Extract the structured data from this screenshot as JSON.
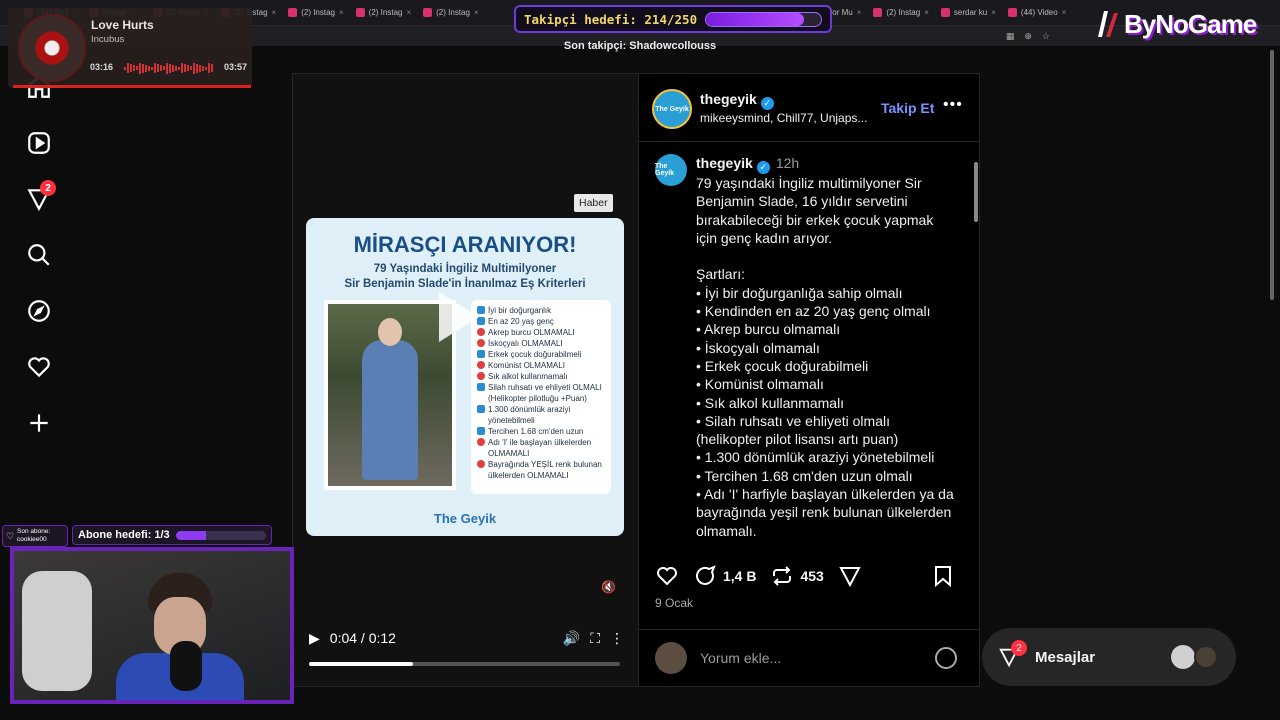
{
  "browser": {
    "tabs": [
      "(44) Youl",
      "Instagr",
      "(2) Instag",
      "(2) Instag",
      "(2) Instag",
      "(2) Instag",
      "(2) Instag",
      "Biliyor Mu",
      "(2) Instag",
      "serdar ku",
      "(44) Video"
    ]
  },
  "stream": {
    "follower_goal_label": "Takipçi hedefi: 214/250",
    "follower_goal_progress": 0.856,
    "last_follower": "Son takipçi: Shadowcollouss",
    "logo": "ByNoGame",
    "music": {
      "title": "Love Hurts",
      "artist": "Incubus",
      "elapsed": "03:16",
      "total": "03:57"
    },
    "last_sub_label": "Son abone:",
    "last_sub_name": "cookiee00",
    "sub_goal_label": "Abone hedefi: 1/3",
    "sub_goal_progress": 0.333
  },
  "nav": {
    "notifications_badge": "2"
  },
  "post": {
    "news_tag": "Haber",
    "card": {
      "headline": "MİRASÇI ARANIYOR!",
      "subtitle1": "79 Yaşındaki İngiliz Multimilyoner",
      "subtitle2": "Sir Benjamin Slade'in İnanılmaz Eş Kriterleri",
      "brand": "The Geyik",
      "list": [
        {
          "ok": true,
          "text": "İyi bir doğurganlık"
        },
        {
          "ok": true,
          "text": "En az 20 yaş genç"
        },
        {
          "ok": false,
          "text": "Akrep burcu OLMAMALI"
        },
        {
          "ok": false,
          "text": "İskoçyalı OLMAMALI"
        },
        {
          "ok": true,
          "text": "Erkek çocuk doğurabilmeli"
        },
        {
          "ok": false,
          "text": "Komünist OLMAMALI"
        },
        {
          "ok": false,
          "text": "Sık alkol kullanmamalı"
        },
        {
          "ok": true,
          "text": "Silah ruhsatı ve ehliyeti OLMALI (Helikopter pilotluğu +Puan)"
        },
        {
          "ok": true,
          "text": "1.300 dönümlük araziyi yönetebilmeli"
        },
        {
          "ok": true,
          "text": "Tercihen 1.68 cm'den uzun"
        },
        {
          "ok": false,
          "text": "Adı 'I' ile başlayan ülkelerden OLMAMALI"
        },
        {
          "ok": false,
          "text": "Bayrağında YEŞİL renk bulunan ülkelerden OLMAMALI"
        }
      ]
    },
    "video": {
      "time": "0:04 / 0:12",
      "progress": 0.333
    },
    "author": "thegeyik",
    "coauthors": "mikeeysmind, Chill77, Unjaps...",
    "follow_label": "Takip Et",
    "avatar_text": "The Geyik",
    "age": "12h",
    "caption": "79 yaşındaki İngiliz multimilyoner Sir Benjamin Slade, 16 yıldır servetini bırakabileceği bir erkek çocuk yapmak için genç kadın arıyor.\n\nŞartları:\n• İyi bir doğurganlığa sahip olmalı\n• Kendinden en az 20 yaş genç olmalı\n• Akrep burcu olmamalı\n• İskoçyalı olmamalı\n• Erkek çocuk doğurabilmeli\n• Komünist olmamalı\n• Sık alkol kullanmamalı\n• Silah ruhsatı ve ehliyeti olmalı (helikopter pilot lisansı artı puan)\n• 1.300 dönümlük araziyi yönetebilmeli\n• Tercihen 1.68 cm'den uzun olmalı\n• Adı 'I' harfiyle başlayan ülkelerden ya da bayrağında yeşil renk bulunan ülkelerden olmamalı.",
    "comments_count": "1,4 B",
    "reposts_count": "453",
    "date": "9 Ocak",
    "comment_placeholder": "Yorum ekle..."
  },
  "messages": {
    "label": "Mesajlar",
    "badge": "2"
  }
}
